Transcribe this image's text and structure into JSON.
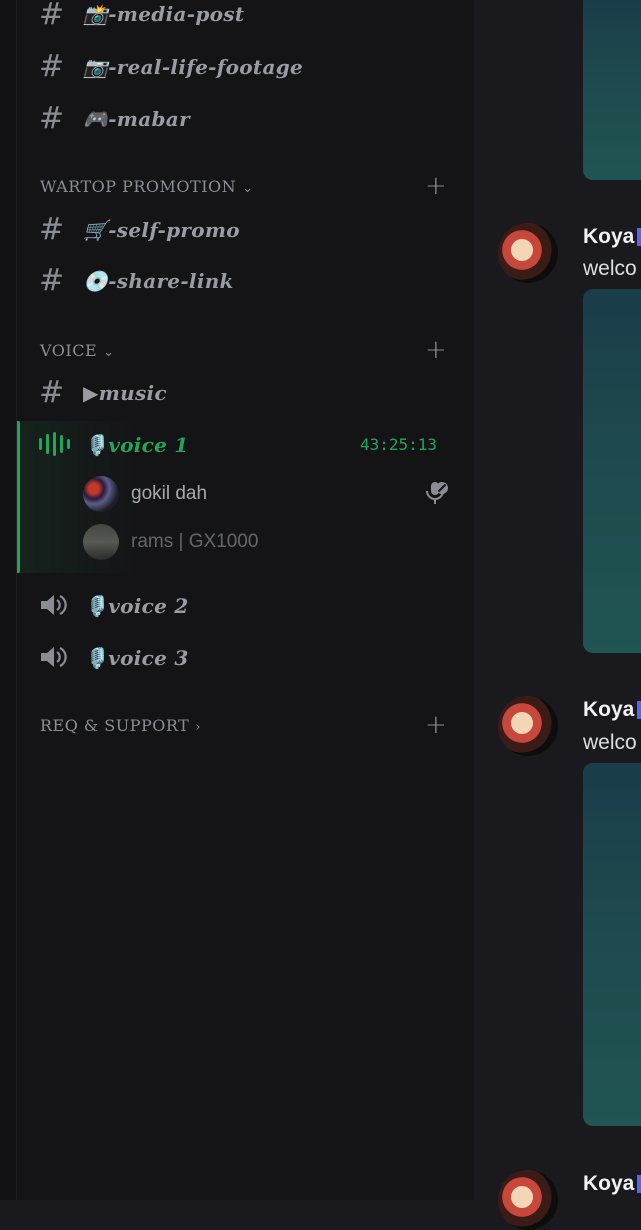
{
  "channels_top": [
    {
      "prefix": "#",
      "name": "📸-media-post"
    },
    {
      "prefix": "#",
      "name": "📷-real-life-footage"
    },
    {
      "prefix": "#",
      "name": "🎮-mabar"
    }
  ],
  "category_promo": {
    "label": "WARTOP PROMOTION",
    "chevron": "⌄"
  },
  "channels_promo": [
    {
      "prefix": "#",
      "name": "🛒-self-promo"
    },
    {
      "prefix": "#",
      "name": "💿-share-link"
    }
  ],
  "category_voice": {
    "label": "VOICE",
    "chevron": "⌄"
  },
  "channel_music": {
    "prefix": "#",
    "name": "▶music"
  },
  "voice_active": {
    "name": "🎙️voice 1",
    "timer": "43:25:13",
    "icon": "sound-wave-icon"
  },
  "voice_users": [
    {
      "name": "gokil dah",
      "status_icon": "mic-muted-icon"
    },
    {
      "name": "rams | GX1000"
    }
  ],
  "voice_channels": [
    {
      "name": "🎙️voice 2",
      "icon": "speaker-icon"
    },
    {
      "name": "🎙️voice 3",
      "icon": "speaker-icon"
    }
  ],
  "category_support": {
    "label": "REQ & SUPPORT",
    "chevron": "›"
  },
  "add_symbol": "+",
  "messages": [
    {
      "author": "Koya",
      "text": "welco"
    },
    {
      "author": "Koya",
      "text": "welco"
    },
    {
      "author": "Koya"
    }
  ],
  "colors": {
    "accent_green": "#23a559",
    "text_muted": "#8b8d94",
    "sidebar_bg": "#141416",
    "chat_bg": "#1a1a1e"
  }
}
